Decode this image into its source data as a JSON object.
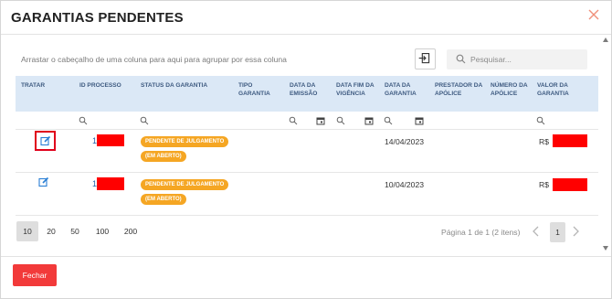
{
  "modal": {
    "title": "GARANTIAS PENDENTES",
    "close_icon": "close-x-icon"
  },
  "toolbar": {
    "group_hint": "Arrastar o cabeçalho de uma coluna para aqui para agrupar por essa coluna",
    "export_icon": "export-icon",
    "search_placeholder": "Pesquisar...",
    "search_value": ""
  },
  "columns": [
    {
      "key": "tratar",
      "label": "TRATAR"
    },
    {
      "key": "id_processo",
      "label": "ID PROCESSO"
    },
    {
      "key": "status",
      "label": "STATUS DA GARANTIA"
    },
    {
      "key": "tipo",
      "label": "TIPO GARANTIA"
    },
    {
      "key": "data_emissao",
      "label": "DATA DA EMISSÃO"
    },
    {
      "key": "data_fim",
      "label": "DATA FIM DA VIGÊNCIA"
    },
    {
      "key": "data_garantia",
      "label": "DATA DA GARANTIA"
    },
    {
      "key": "prestador",
      "label": "PRESTADOR DA APÓLICE"
    },
    {
      "key": "numero",
      "label": "NÚMERO DA APÓLICE"
    },
    {
      "key": "valor",
      "label": "VALOR DA GARANTIA"
    }
  ],
  "rows": [
    {
      "id_prefix": "1",
      "status_badges": [
        "PENDENTE DE JULGAMENTO",
        "(EM ABERTO)"
      ],
      "data_garantia": "14/04/2023",
      "valor_prefix": "R$",
      "edit_highlighted": true
    },
    {
      "id_prefix": "1",
      "status_badges": [
        "PENDENTE DE JULGAMENTO",
        "(EM ABERTO)"
      ],
      "data_garantia": "10/04/2023",
      "valor_prefix": "R$",
      "edit_highlighted": false
    }
  ],
  "pager": {
    "page_sizes": [
      "10",
      "20",
      "50",
      "100",
      "200"
    ],
    "active_size": "10",
    "info": "Página 1 de 1 (2 itens)",
    "current_page": "1"
  },
  "footer": {
    "close_label": "Fechar"
  },
  "colors": {
    "accent_red": "#f23a3a",
    "badge_orange": "#f5a623",
    "header_blue": "#dbe8f6",
    "link_blue": "#1d5fa8",
    "redaction": "#ff0000"
  }
}
